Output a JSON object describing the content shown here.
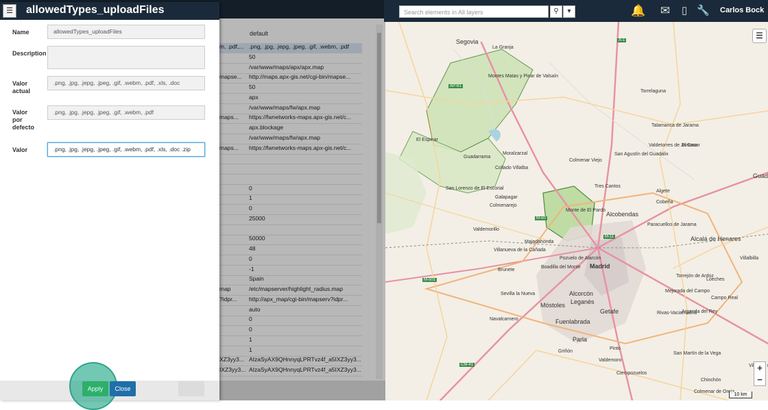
{
  "topbar": {
    "search_placeholder": "Search elements in All layers",
    "search_icon": "search-icon",
    "dropdown_icon": "chevron-down-icon",
    "icons": [
      "bell-icon",
      "mail-icon",
      "mobile-icon",
      "wrench-icon"
    ],
    "user_name": "Carlos Bock",
    "bg_color": "#1b2a3a",
    "bell_color": "#e53935"
  },
  "dialog": {
    "title": "allowedTypes_uploadFiles",
    "name_label": "Name",
    "name_value": "allowedTypes_uploadFiles",
    "description_label": "Description",
    "description_value": "",
    "current_label_1": "Valor",
    "current_label_2": "actual",
    "current_value": ".png, .jpg, .jepg, .jpeg, .gif, .webm, .pdf, .xls, .doc",
    "default_label_1": "Valor",
    "default_label_2": "por",
    "default_label_3": "defecto",
    "default_value": ".png, .jpg, .jepg, .jpeg, .gif, .webm, .pdf",
    "value_label": "Valor",
    "value_input": ".png, .jpg, .jepg, .jpeg, .gif, .webm, .pdf, .xls, .doc .zip",
    "apply_label": "Apply",
    "close_label": "Close"
  },
  "table": {
    "column_default": "default",
    "rows": [
      {
        "c1": "m, .pdf,...",
        "c2": ".png, .jpg, .jepg, .jpeg, .gif, .webm, .pdf",
        "selected": true
      },
      {
        "c1": "",
        "c2": "50"
      },
      {
        "c1": "",
        "c2": "/var/www/maps/apx/apx.map"
      },
      {
        "c1": "mapse...",
        "c2": "http://maps.apx-gis.net/cgi-bin/mapse..."
      },
      {
        "c1": "",
        "c2": "50"
      },
      {
        "c1": "",
        "c2": "apx"
      },
      {
        "c1": "",
        "c2": "/var/www/maps/fw/apx.map"
      },
      {
        "c1": "maps...",
        "c2": "https://fwnetworks-maps.apx-gis.net/c..."
      },
      {
        "c1": "",
        "c2": "apx.blockage"
      },
      {
        "c1": "",
        "c2": "/var/www/maps/fw/apx.map"
      },
      {
        "c1": "maps...",
        "c2": "https://fwnetworks-maps.apx-gis.net/c..."
      },
      {
        "c1": "",
        "c2": ""
      },
      {
        "c1": "",
        "c2": ""
      },
      {
        "c1": "",
        "c2": ""
      },
      {
        "c1": "",
        "c2": "0"
      },
      {
        "c1": "",
        "c2": "1"
      },
      {
        "c1": "",
        "c2": "0"
      },
      {
        "c1": "",
        "c2": "25000"
      },
      {
        "c1": "",
        "c2": ""
      },
      {
        "c1": "",
        "c2": "50000"
      },
      {
        "c1": "",
        "c2": "48"
      },
      {
        "c1": "",
        "c2": "0"
      },
      {
        "c1": "",
        "c2": "-1"
      },
      {
        "c1": "",
        "c2": "Spain"
      },
      {
        "c1": "map",
        "c2": "/etc/mapserver/highlight_radius.map"
      },
      {
        "c1": "?idpr...",
        "c2": "http://apx_map/cgi-bin/mapserv?idpr..."
      },
      {
        "c1": "",
        "c2": "auto"
      },
      {
        "c1": "",
        "c2": "0"
      },
      {
        "c1": "",
        "c2": "0"
      },
      {
        "c1": "",
        "c2": "1"
      },
      {
        "c1": "",
        "c2": "1"
      },
      {
        "c1": "XZ3yy3...",
        "c2": "AIzaSyAX9QHnnyqLPRTvz4f_a5IXZ3yy3..."
      },
      {
        "c1": "IXZ3yy3...",
        "c2": "AIzaSyAX9QHnnyqLPRTvz4f_a5IXZ3yy3..."
      }
    ]
  },
  "map": {
    "layers_icon": "layers-icon",
    "zoom_in": "+",
    "zoom_out": "−",
    "scale": "10 km",
    "labels": [
      {
        "t": "Segovia",
        "cls": "big"
      },
      {
        "t": "La Granja",
        "cls": ""
      },
      {
        "t": "Montes Matas y Pinar de Valsaín",
        "cls": ""
      },
      {
        "t": "Torrelaguna",
        "cls": ""
      },
      {
        "t": "El Espinar",
        "cls": ""
      },
      {
        "t": "Talamanca de Jarama",
        "cls": ""
      },
      {
        "t": "Guadarrama",
        "cls": ""
      },
      {
        "t": "Moralzarzal",
        "cls": ""
      },
      {
        "t": "Colmenar Viejo",
        "cls": ""
      },
      {
        "t": "San Agustín del Guadalix",
        "cls": ""
      },
      {
        "t": "Valdetorres de Jarama",
        "cls": ""
      },
      {
        "t": "El Casar",
        "cls": ""
      },
      {
        "t": "Collado Villalba",
        "cls": ""
      },
      {
        "t": "Tres Cantos",
        "cls": ""
      },
      {
        "t": "San Lorenzo de El Escorial",
        "cls": ""
      },
      {
        "t": "Galapagar",
        "cls": ""
      },
      {
        "t": "Colmenarejo",
        "cls": ""
      },
      {
        "t": "Algete",
        "cls": ""
      },
      {
        "t": "Cobeña",
        "cls": ""
      },
      {
        "t": "Guadalajara",
        "cls": "big"
      },
      {
        "t": "Monte de El Pardo",
        "cls": ""
      },
      {
        "t": "Alcobendas",
        "cls": "big"
      },
      {
        "t": "Valdemorillo",
        "cls": ""
      },
      {
        "t": "Majadahonda",
        "cls": ""
      },
      {
        "t": "Paracuellos de Jarama",
        "cls": ""
      },
      {
        "t": "Alcalá de Henares",
        "cls": "big"
      },
      {
        "t": "Villanueva de la Cañada",
        "cls": ""
      },
      {
        "t": "Pozuelo de Alarcón",
        "cls": ""
      },
      {
        "t": "Madrid",
        "cls": "city"
      },
      {
        "t": "Boadilla del Monte",
        "cls": ""
      },
      {
        "t": "Brunete",
        "cls": ""
      },
      {
        "t": "Villalbilla",
        "cls": ""
      },
      {
        "t": "Torrejón de Ardoz",
        "cls": ""
      },
      {
        "t": "Mejorada del Campo",
        "cls": ""
      },
      {
        "t": "Loeches",
        "cls": ""
      },
      {
        "t": "Alcorcón",
        "cls": "big"
      },
      {
        "t": "Sevilla la Nueva",
        "cls": ""
      },
      {
        "t": "Móstoles",
        "cls": "big"
      },
      {
        "t": "Leganés",
        "cls": "big"
      },
      {
        "t": "Getafe",
        "cls": "big"
      },
      {
        "t": "Rivas-Vaciamadrid",
        "cls": ""
      },
      {
        "t": "Campo Real",
        "cls": ""
      },
      {
        "t": "Arganda del Rey",
        "cls": ""
      },
      {
        "t": "Navalcarnero",
        "cls": ""
      },
      {
        "t": "Fuenlabrada",
        "cls": "big"
      },
      {
        "t": "Parla",
        "cls": "big"
      },
      {
        "t": "Pinto",
        "cls": ""
      },
      {
        "t": "Griñón",
        "cls": ""
      },
      {
        "t": "San Martín de la Vega",
        "cls": ""
      },
      {
        "t": "Valdemoro",
        "cls": ""
      },
      {
        "t": "Ciempozuelos",
        "cls": ""
      },
      {
        "t": "Villarejo de Salvanés",
        "cls": ""
      },
      {
        "t": "Chinchón",
        "cls": ""
      },
      {
        "t": "Colmenar de Oreja",
        "cls": ""
      }
    ],
    "roads": [
      "A-1",
      "AP-61",
      "M-50",
      "M-11",
      "M-501",
      "CM-41"
    ]
  }
}
